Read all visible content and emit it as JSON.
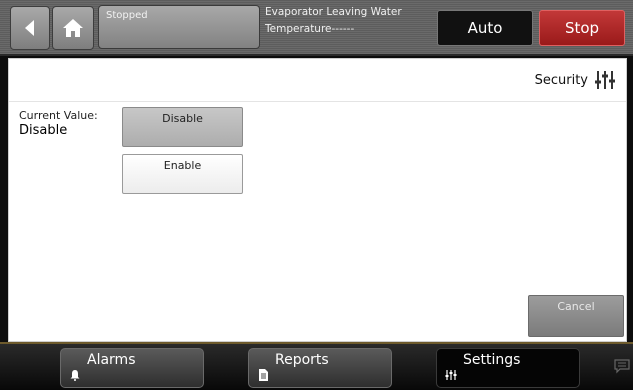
{
  "topbar": {
    "status": "Stopped",
    "temperature_line1": "Evaporator Leaving Water",
    "temperature_line2": "Temperature------",
    "auto_label": "Auto",
    "stop_label": "Stop",
    "stop_color": "#b52a2a",
    "icons": {
      "back": "back-arrow-icon",
      "home": "home-icon"
    }
  },
  "main": {
    "title": "Security",
    "title_icon": "sliders-icon",
    "current_value_label": "Current Value:",
    "current_value": "Disable",
    "options": [
      {
        "label": "Disable",
        "selected": true
      },
      {
        "label": "Enable",
        "selected": false
      }
    ],
    "cancel_label": "Cancel"
  },
  "nav": {
    "items": [
      {
        "label": "Alarms",
        "icon": "bell-icon",
        "active": false
      },
      {
        "label": "Reports",
        "icon": "document-icon",
        "active": false
      },
      {
        "label": "Settings",
        "icon": "sliders-icon",
        "active": true
      }
    ],
    "chat_icon": "chat-icon"
  }
}
